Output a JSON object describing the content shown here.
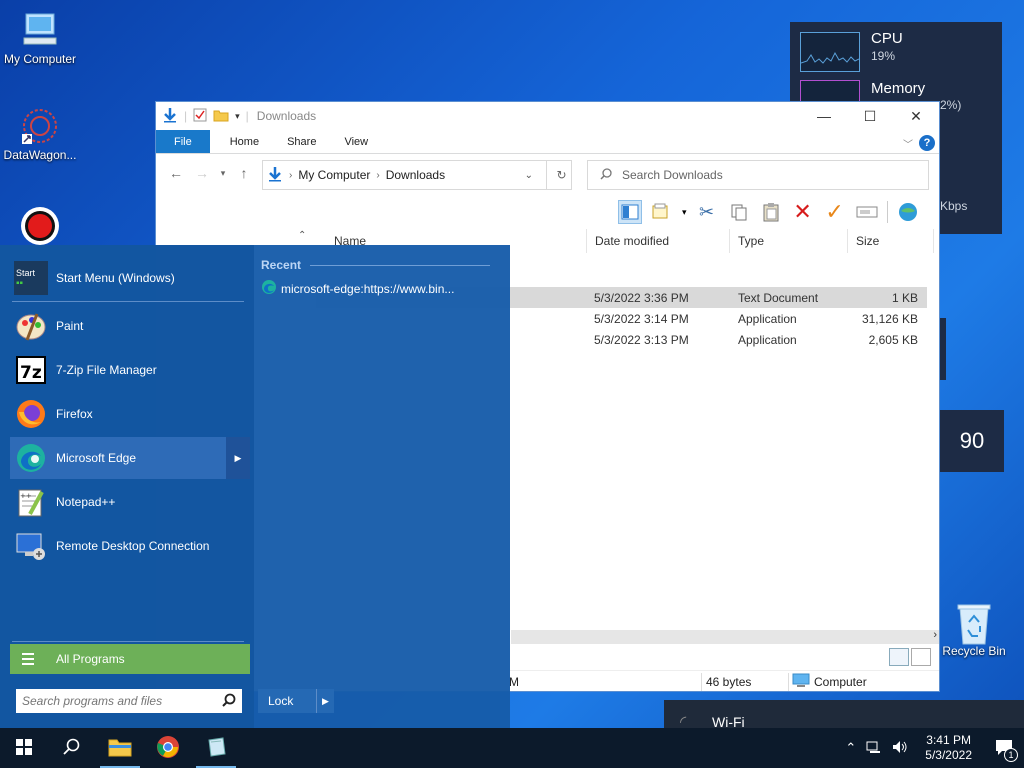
{
  "desktop": {
    "icons": [
      {
        "label": "My Computer"
      },
      {
        "label": "DataWagon..."
      },
      {
        "label": ""
      },
      {
        "label": "Recycle Bin"
      }
    ]
  },
  "widgets": {
    "cpu_title": "CPU",
    "cpu_value": "19%",
    "memory_title": "Memory",
    "memory_value": "2%)",
    "network_value": "Kbps",
    "temp_value": "90"
  },
  "explorer": {
    "title": "Downloads",
    "tabs": [
      "File",
      "Home",
      "Share",
      "View"
    ],
    "help_label": "?",
    "breadcrumb": [
      "My Computer",
      "Downloads"
    ],
    "search_placeholder": "Search Downloads",
    "columns": [
      "Name",
      "Date modified",
      "Type",
      "Size"
    ],
    "rows": [
      {
        "date": "5/3/2022 3:36 PM",
        "type": "Text Document",
        "size": "1 KB",
        "selected": true
      },
      {
        "date": "5/3/2022 3:14 PM",
        "type": "Application",
        "size": "31,126 KB",
        "selected": false
      },
      {
        "date": "5/3/2022 3:13 PM",
        "type": "Application",
        "size": "2,605 KB",
        "selected": false
      }
    ],
    "status_left": "M",
    "status_bytes": "46 bytes",
    "status_location": "Computer"
  },
  "start_menu": {
    "items": [
      {
        "label": "Start Menu (Windows)",
        "icon": "start-menu-icon"
      },
      {
        "label": "Paint",
        "icon": "paint-icon"
      },
      {
        "label": "7-Zip File Manager",
        "icon": "7zip-icon"
      },
      {
        "label": "Firefox",
        "icon": "firefox-icon"
      },
      {
        "label": "Microsoft Edge",
        "icon": "edge-icon"
      },
      {
        "label": "Notepad++",
        "icon": "notepadpp-icon"
      },
      {
        "label": "Remote Desktop Connection",
        "icon": "remote-desktop-icon"
      }
    ],
    "start_icon_text": "Start",
    "all_programs": "All Programs",
    "search_placeholder": "Search programs and files",
    "lock_label": "Lock",
    "recent_title": "Recent",
    "recent_items": [
      "microsoft-edge:https://www.bin..."
    ]
  },
  "wifi": {
    "title": "Wi-Fi"
  },
  "taskbar": {
    "time": "3:41 PM",
    "date": "5/3/2022",
    "notification_count": "1"
  },
  "colors": {
    "accent": "#1979ca",
    "all_programs": "#6db058"
  }
}
